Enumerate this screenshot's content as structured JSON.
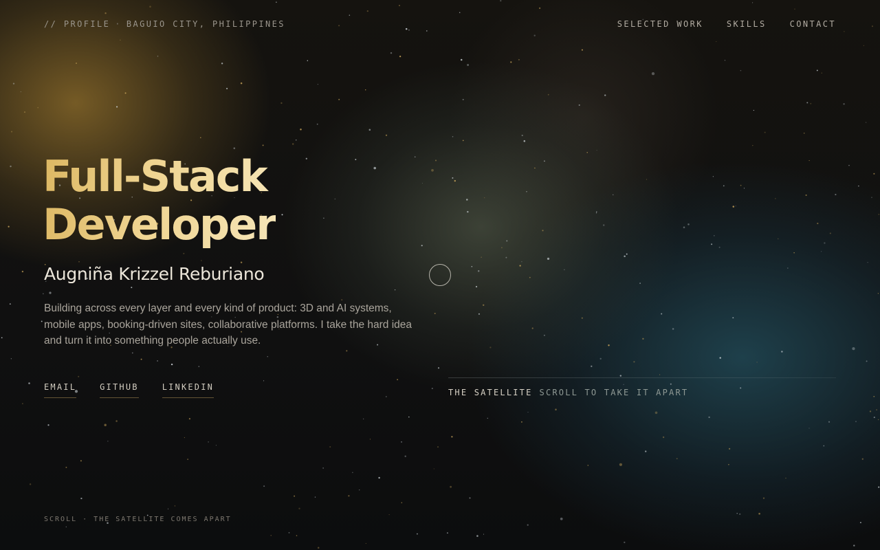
{
  "header": {
    "prefix": "// PROFILE",
    "separator": "·",
    "location": "BAGUIO CITY, PHILIPPINES"
  },
  "nav": {
    "items": [
      {
        "label": "SELECTED WORK"
      },
      {
        "label": "SKILLS"
      },
      {
        "label": "CONTACT"
      }
    ]
  },
  "hero": {
    "title_line1": "Full-Stack",
    "title_line2": "Developer",
    "name": "Augniña Krizzel Reburiano",
    "description": "Building across every layer and every kind of product: 3D and AI systems, mobile apps, booking-driven sites, collaborative platforms. I take the hard idea and turn it into something people actually use."
  },
  "links": {
    "items": [
      {
        "label": "EMAIL"
      },
      {
        "label": "GITHUB"
      },
      {
        "label": "LINKEDIN"
      }
    ]
  },
  "satellite": {
    "label": "THE SATELLITE",
    "hint": "SCROLL TO TAKE IT APART"
  },
  "footer": {
    "hint": "SCROLL · THE SATELLITE COMES APART"
  },
  "colors": {
    "accent_gold": "#e8c878",
    "text_light": "#ece6da",
    "text_muted": "#aaa59c",
    "background": "#101010"
  }
}
